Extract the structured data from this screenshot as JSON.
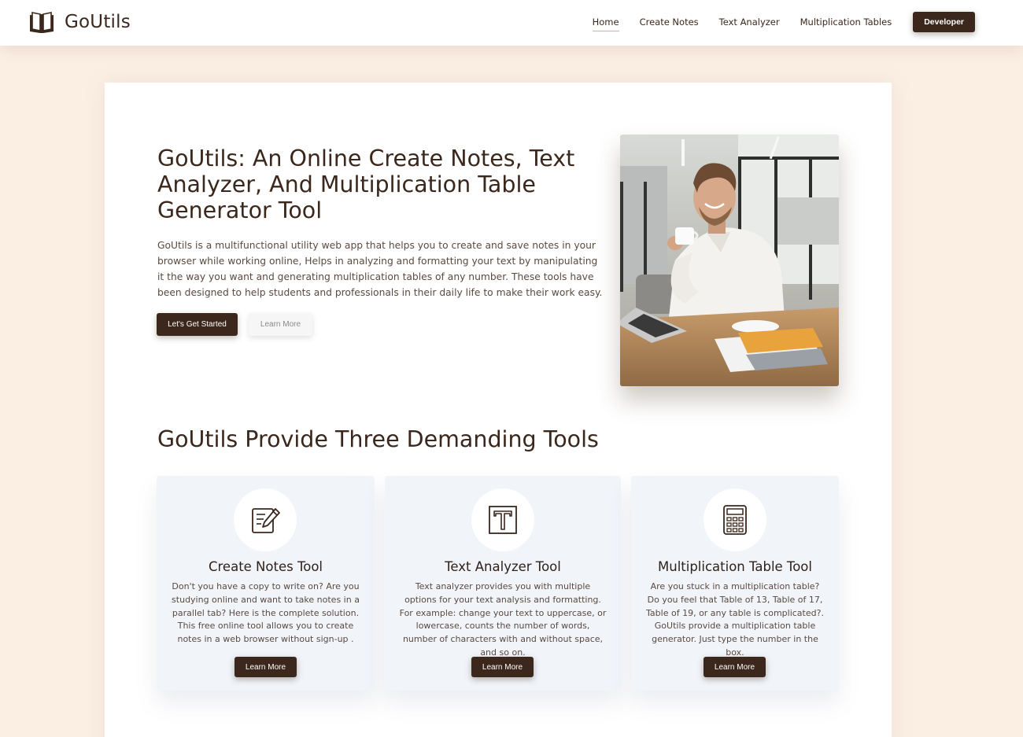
{
  "brand": {
    "name": "GoUtils",
    "icon": "book-icon"
  },
  "nav": {
    "links": [
      {
        "label": "Home",
        "active": true
      },
      {
        "label": "Create Notes"
      },
      {
        "label": "Text Analyzer"
      },
      {
        "label": "Multiplication Tables"
      }
    ],
    "developer_label": "Developer"
  },
  "hero": {
    "title": "GoUtils: An Online Create Notes, Text Analyzer, And Multiplication Table Generator Tool",
    "description": "GoUtils is a multifunctional utility web app that helps you to create and save notes in your browser while working online, Helps in analyzing and formatting your text by manipulating it the way you want and generating multiplication tables of any number. These tools have been designed to help students and professionals in their daily life to make their work easy.",
    "primary_button": "Let's Get Started",
    "secondary_button": "Learn More"
  },
  "tools_section": {
    "title": "GoUtils Provide Three Demanding Tools",
    "tools": [
      {
        "icon": "notes-edit-icon",
        "title": "Create Notes Tool",
        "description": "Don't you have a copy to write on? Are you studying online and want to take notes in a parallel tab? Here is the complete solution. This free online tool allows you to create notes in a web browser without sign-up .",
        "button": "Learn More"
      },
      {
        "icon": "text-t-icon",
        "title": "Text Analyzer Tool",
        "description": "Text analyzer provides you with multiple options for your text analysis and formatting. For example: change your text to uppercase, or lowercase, counts the number of words, number of characters with and without space, and so on.",
        "button": "Learn More"
      },
      {
        "icon": "calculator-icon",
        "title": "Multiplication Table Tool",
        "description": "Are you stuck in a multiplication table? Do you feel that Table of 13, Table of 17, Table of 19, or any table is complicated?. GoUtils provide a multiplication table generator. Just type the number in the box.",
        "button": "Learn More"
      }
    ]
  },
  "colors": {
    "brand_dark": "#3b271b",
    "page_background": "#fbefe4",
    "card_background": "#f1f4f9",
    "nav_active_underline": "#d9b58a"
  }
}
